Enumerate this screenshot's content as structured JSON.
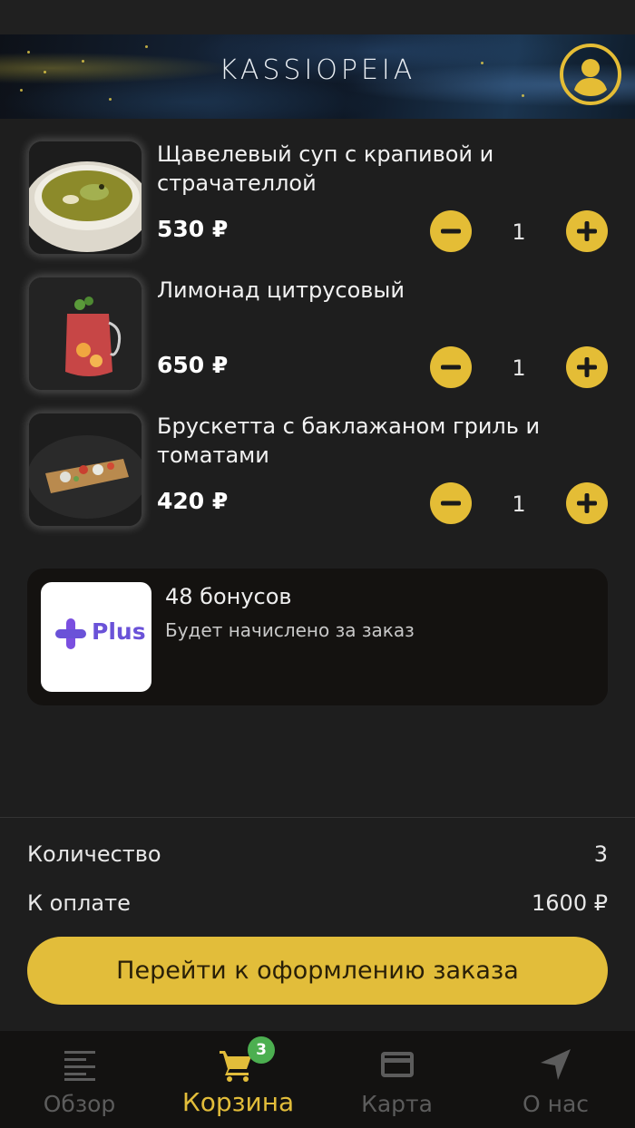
{
  "header": {
    "logo": "KASSIOPEIA",
    "profile_icon": "user-circle-icon"
  },
  "cart": {
    "items": [
      {
        "title": "Щавелевый суп с крапивой и страчателлой",
        "price": "530 ₽",
        "quantity": "1",
        "image": "soup-photo"
      },
      {
        "title": "Лимонад цитрусовый",
        "price": "650 ₽",
        "quantity": "1",
        "image": "lemonade-photo"
      },
      {
        "title": "Брускетта с баклажаном гриль и томатами",
        "price": "420 ₽",
        "quantity": "1",
        "image": "bruschetta-photo"
      }
    ],
    "minus_icon": "minus-icon",
    "plus_icon": "plus-icon"
  },
  "bonus": {
    "logo_text": "Plus",
    "title": "48 бонусов",
    "subtitle": "Будет начислено за заказ"
  },
  "summary": {
    "quantity_label": "Количество",
    "quantity_value": "3",
    "total_label": "К оплате",
    "total_value": "1600 ₽",
    "checkout_label": "Перейти к оформлению заказа"
  },
  "tabbar": {
    "tabs": [
      {
        "label": "Обзор",
        "icon": "list-icon",
        "active": false
      },
      {
        "label": "Корзина",
        "icon": "cart-icon",
        "active": true,
        "badge": "3"
      },
      {
        "label": "Карта",
        "icon": "card-icon",
        "active": false
      },
      {
        "label": "О нас",
        "icon": "location-arrow-icon",
        "active": false
      }
    ]
  },
  "colors": {
    "accent": "#e2bd3a",
    "background": "#1e1e1e",
    "badge": "#4caf50",
    "plus_brand": "#6a52d8"
  }
}
